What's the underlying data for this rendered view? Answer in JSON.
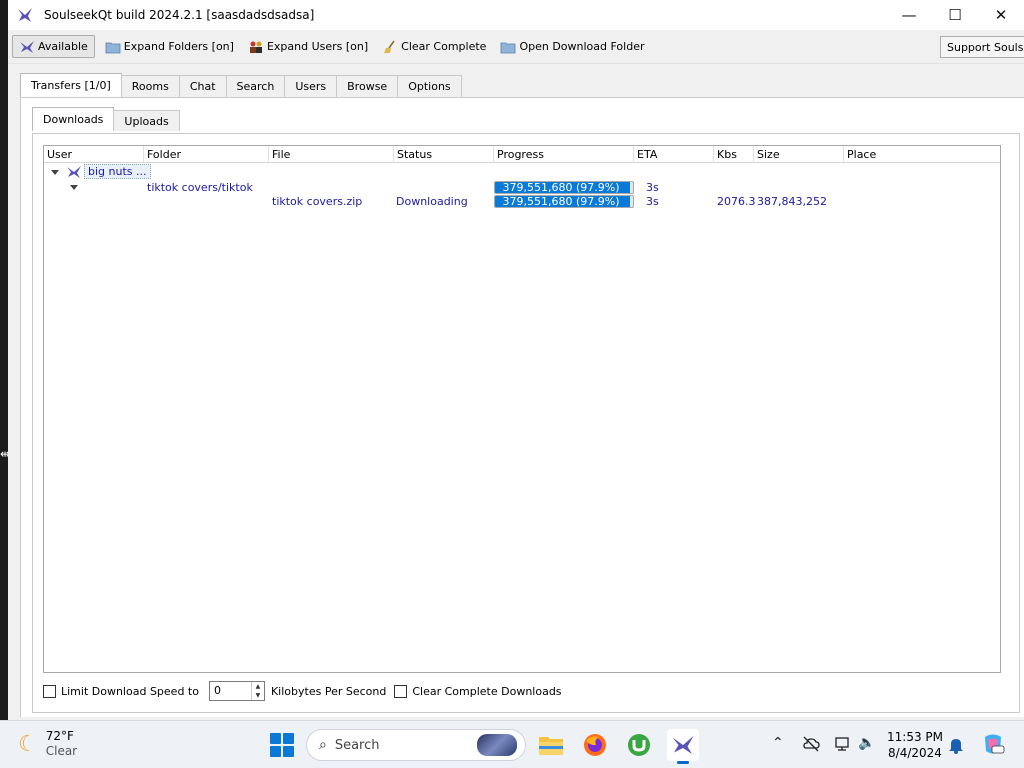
{
  "window": {
    "title": "SoulseekQt build 2024.2.1 [saasdadsdsadsa]",
    "controls": {
      "minimize": "—",
      "maximize": "☐",
      "close": "✕"
    }
  },
  "toolbar": {
    "available": "Available",
    "expand_folders": "Expand Folders [on]",
    "expand_users": "Expand Users [on]",
    "clear_complete": "Clear Complete",
    "open_download_folder": "Open Download Folder",
    "support": "Support Soulseek"
  },
  "main_tabs": [
    "Transfers [1/0]",
    "Rooms",
    "Chat",
    "Search",
    "Users",
    "Browse",
    "Options"
  ],
  "sub_tabs": [
    "Downloads",
    "Uploads"
  ],
  "table": {
    "columns": [
      "User",
      "Folder",
      "File",
      "Status",
      "Progress",
      "ETA",
      "Kbs",
      "Size",
      "Place"
    ],
    "user": "big nuts ...",
    "folder": {
      "name": "tiktok covers/tiktok",
      "progress_text": "379,551,680 (97.9%)",
      "progress": 0.979,
      "eta": "3s"
    },
    "file": {
      "name": "tiktok covers.zip",
      "status": "Downloading",
      "progress_text": "379,551,680 (97.9%)",
      "progress": 0.979,
      "eta": "3s",
      "kbs": "2076.3",
      "size": "387,843,252"
    }
  },
  "bottom": {
    "limit_label": "Limit Download Speed to",
    "limit_value": "0",
    "unit_label": "Kilobytes Per Second",
    "clear_label": "Clear Complete Downloads"
  },
  "taskbar": {
    "temperature": "72°F",
    "condition": "Clear",
    "search_label": "Search",
    "time": "11:53 PM",
    "date": "8/4/2024"
  },
  "colors": {
    "progress_fill": "#0a7ad8",
    "link_text": "#1a1aa0",
    "accent": "#0a78d7"
  }
}
